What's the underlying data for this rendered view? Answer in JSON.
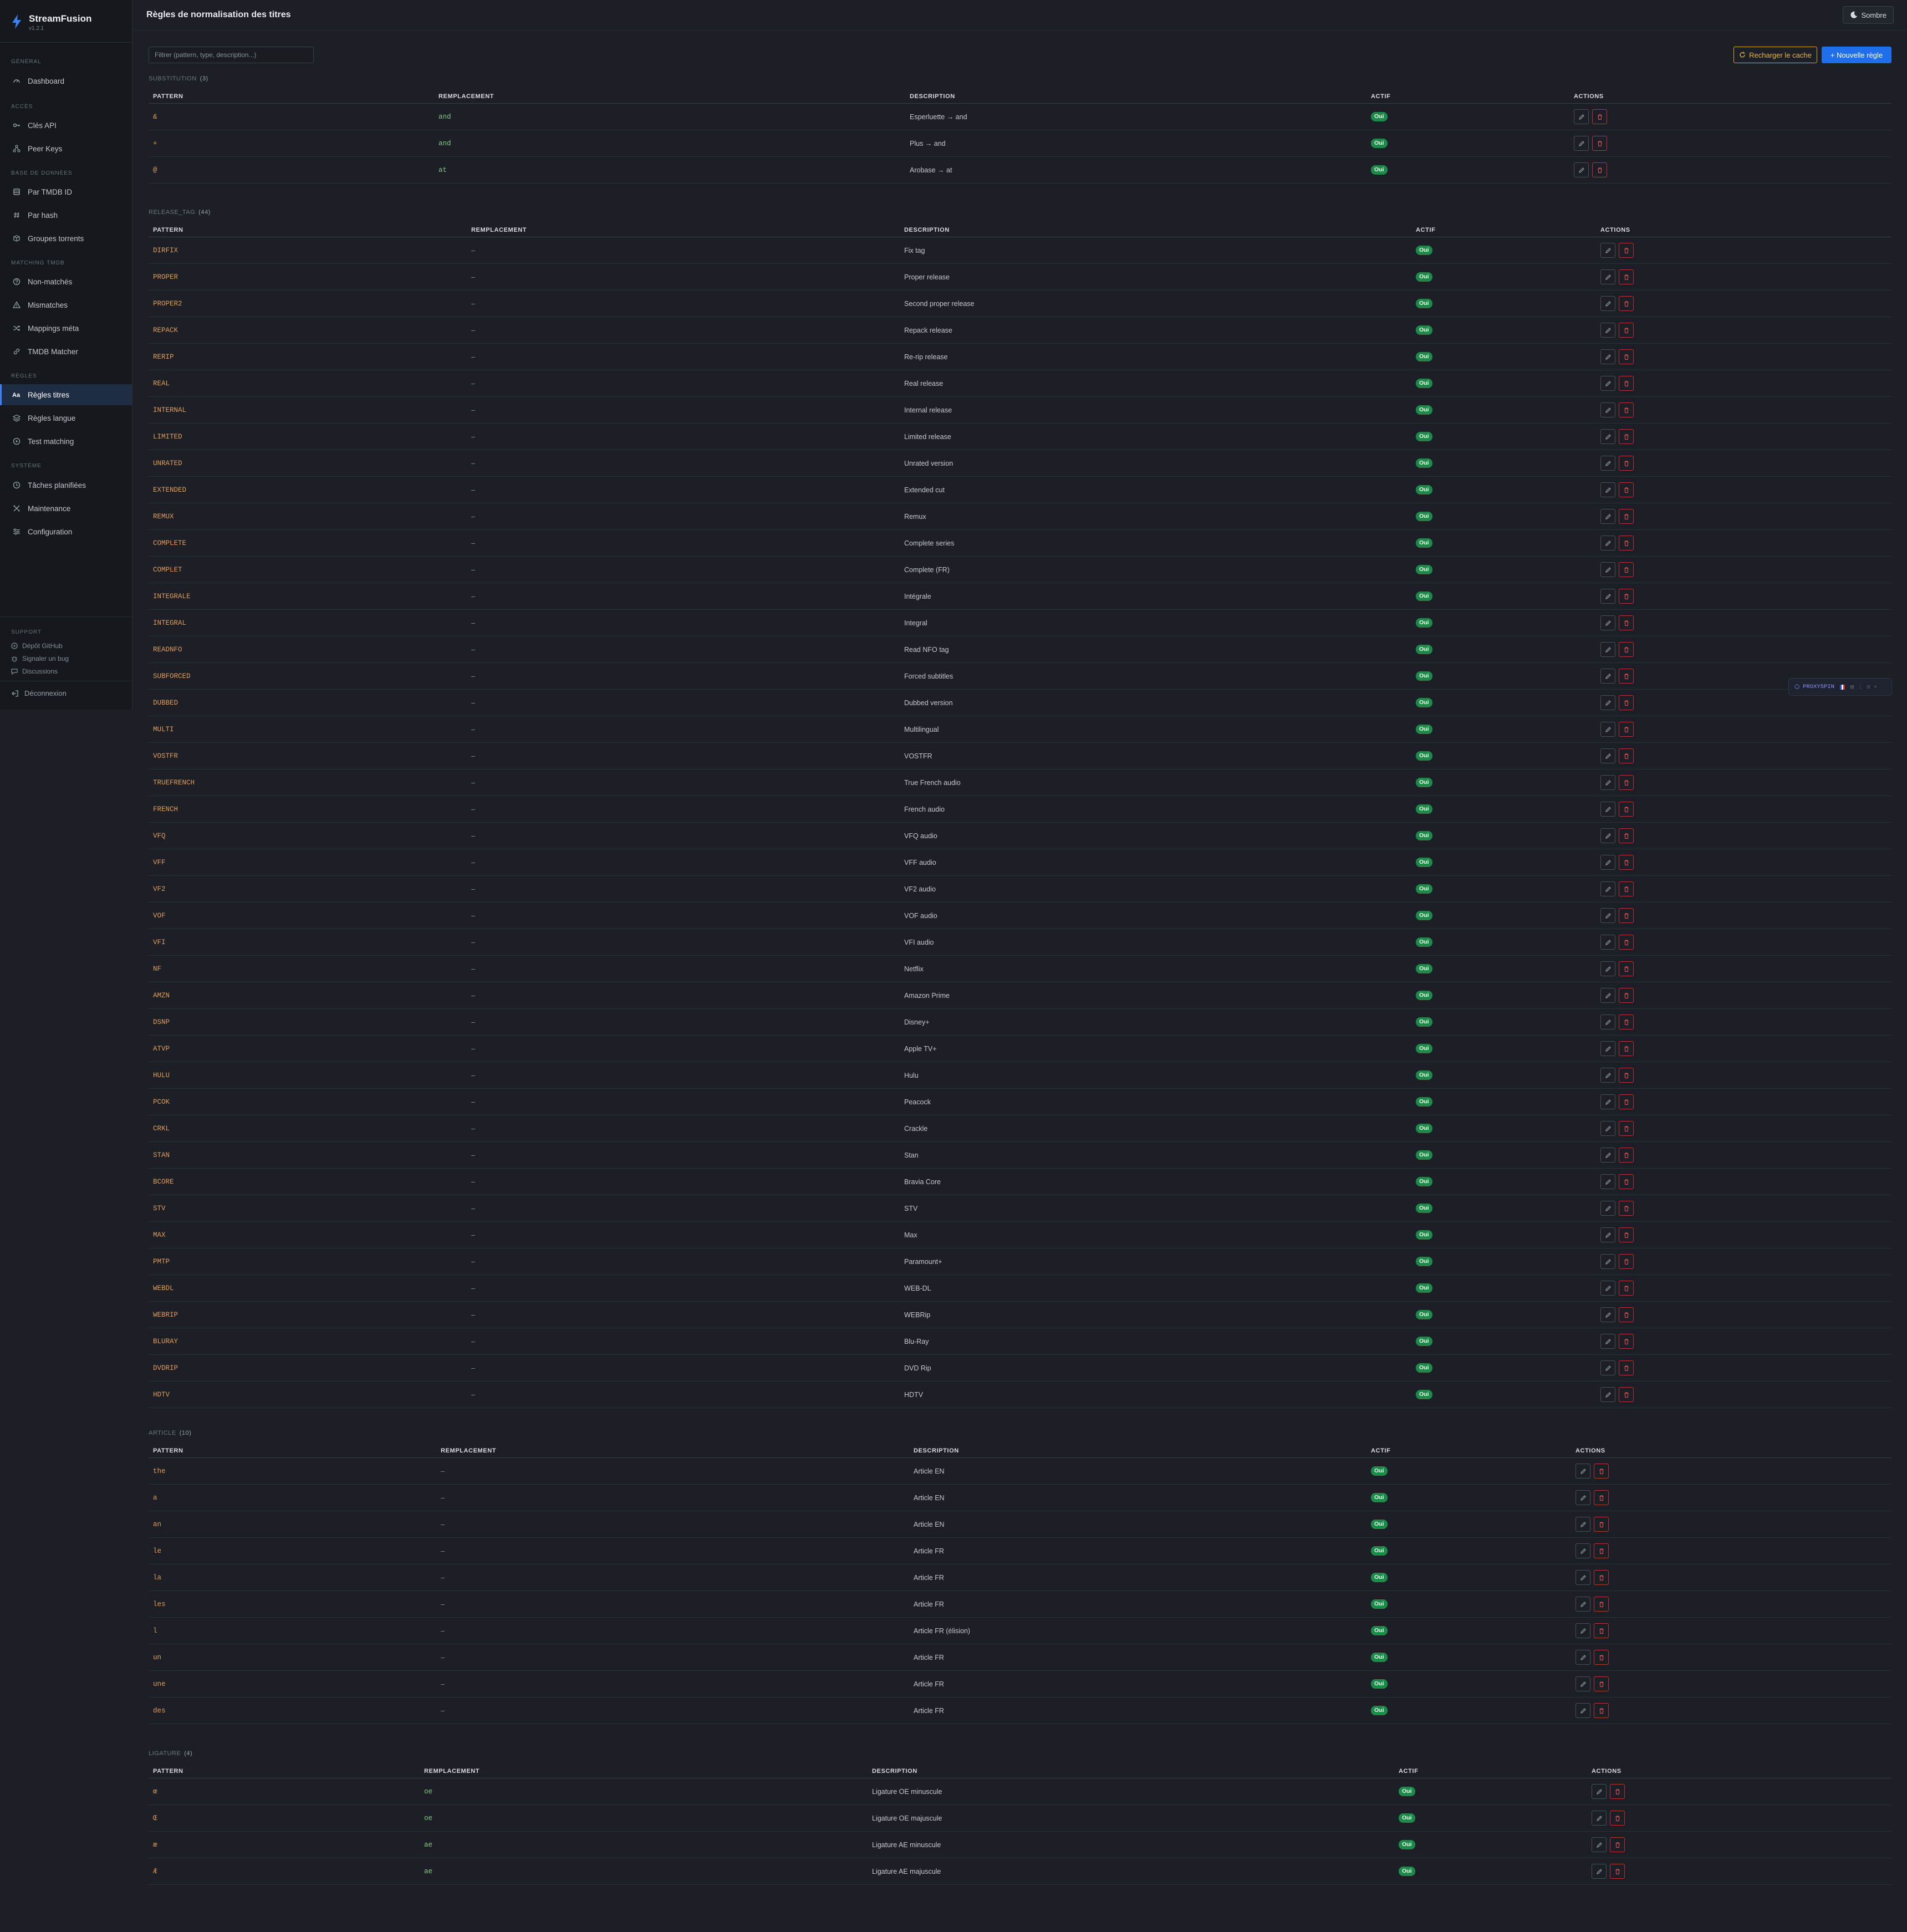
{
  "app": {
    "name": "StreamFusion",
    "version": "v1.2.1"
  },
  "header": {
    "title": "Règles de normalisation des titres",
    "theme_label": "Sombre"
  },
  "sidebar": {
    "sections": [
      {
        "label": "GÉNÉRAL",
        "items": [
          {
            "label": "Dashboard",
            "icon": "gauge-icon"
          }
        ]
      },
      {
        "label": "ACCÈS",
        "items": [
          {
            "label": "Clés API",
            "icon": "key-icon"
          },
          {
            "label": "Peer Keys",
            "icon": "network-icon"
          }
        ]
      },
      {
        "label": "BASE DE DONNÉES",
        "items": [
          {
            "label": "Par TMDB ID",
            "icon": "database-icon"
          },
          {
            "label": "Par hash",
            "icon": "hash-icon"
          },
          {
            "label": "Groupes torrents",
            "icon": "box-icon"
          }
        ]
      },
      {
        "label": "MATCHING TMDB",
        "items": [
          {
            "label": "Non-matchés",
            "icon": "question-icon"
          },
          {
            "label": "Mismatches",
            "icon": "warning-icon"
          },
          {
            "label": "Mappings méta",
            "icon": "shuffle-icon"
          },
          {
            "label": "TMDB Matcher",
            "icon": "link-icon"
          }
        ]
      },
      {
        "label": "RÈGLES",
        "items": [
          {
            "label": "Règles titres",
            "icon": "text-case-icon",
            "active": true
          },
          {
            "label": "Règles langue",
            "icon": "stack-icon"
          },
          {
            "label": "Test matching",
            "icon": "play-circle-icon"
          }
        ]
      },
      {
        "label": "SYSTÈME",
        "items": [
          {
            "label": "Tâches planifiées",
            "icon": "clock-icon"
          },
          {
            "label": "Maintenance",
            "icon": "tools-icon"
          },
          {
            "label": "Configuration",
            "icon": "sliders-icon"
          }
        ]
      }
    ],
    "support": {
      "label": "SUPPORT",
      "items": [
        {
          "label": "Dépôt GitHub",
          "icon": "github-icon"
        },
        {
          "label": "Signaler un bug",
          "icon": "bug-icon"
        },
        {
          "label": "Discussions",
          "icon": "chat-icon"
        }
      ]
    },
    "logout_label": "Déconnexion"
  },
  "toolbar": {
    "filter_placeholder": "Filtrer (pattern, type, description...)",
    "reload_label": "Recharger le cache",
    "new_label": "+ Nouvelle règle"
  },
  "columns": {
    "pattern": "PATTERN",
    "replacement": "REMPLACEMENT",
    "description": "DESCRIPTION",
    "active": "ACTIF",
    "actions": "ACTIONS"
  },
  "active_label": "Oui",
  "groups": [
    {
      "name": "SUBSTITUTION",
      "count": "(3)",
      "rows": [
        {
          "pattern": "&",
          "replacement": "and",
          "description": "Esperluette → and"
        },
        {
          "pattern": "+",
          "replacement": "and",
          "description": "Plus → and"
        },
        {
          "pattern": "@",
          "replacement": "at",
          "description": "Arobase → at"
        }
      ]
    },
    {
      "name": "RELEASE_TAG",
      "count": "(44)",
      "rows": [
        {
          "pattern": "DIRFIX",
          "replacement": "–",
          "description": "Fix tag"
        },
        {
          "pattern": "PROPER",
          "replacement": "–",
          "description": "Proper release"
        },
        {
          "pattern": "PROPER2",
          "replacement": "–",
          "description": "Second proper release"
        },
        {
          "pattern": "REPACK",
          "replacement": "–",
          "description": "Repack release"
        },
        {
          "pattern": "RERIP",
          "replacement": "–",
          "description": "Re-rip release"
        },
        {
          "pattern": "REAL",
          "replacement": "–",
          "description": "Real release"
        },
        {
          "pattern": "INTERNAL",
          "replacement": "–",
          "description": "Internal release"
        },
        {
          "pattern": "LIMITED",
          "replacement": "–",
          "description": "Limited release"
        },
        {
          "pattern": "UNRATED",
          "replacement": "–",
          "description": "Unrated version"
        },
        {
          "pattern": "EXTENDED",
          "replacement": "–",
          "description": "Extended cut"
        },
        {
          "pattern": "REMUX",
          "replacement": "–",
          "description": "Remux"
        },
        {
          "pattern": "COMPLETE",
          "replacement": "–",
          "description": "Complete series"
        },
        {
          "pattern": "COMPLET",
          "replacement": "–",
          "description": "Complete (FR)"
        },
        {
          "pattern": "INTEGRALE",
          "replacement": "–",
          "description": "Intégrale"
        },
        {
          "pattern": "INTEGRAL",
          "replacement": "–",
          "description": "Integral"
        },
        {
          "pattern": "READNFO",
          "replacement": "–",
          "description": "Read NFO tag"
        },
        {
          "pattern": "SUBFORCED",
          "replacement": "–",
          "description": "Forced subtitles"
        },
        {
          "pattern": "DUBBED",
          "replacement": "–",
          "description": "Dubbed version"
        },
        {
          "pattern": "MULTI",
          "replacement": "–",
          "description": "Multilingual"
        },
        {
          "pattern": "VOSTFR",
          "replacement": "–",
          "description": "VOSTFR"
        },
        {
          "pattern": "TRUEFRENCH",
          "replacement": "–",
          "description": "True French audio"
        },
        {
          "pattern": "FRENCH",
          "replacement": "–",
          "description": "French audio"
        },
        {
          "pattern": "VFQ",
          "replacement": "–",
          "description": "VFQ audio"
        },
        {
          "pattern": "VFF",
          "replacement": "–",
          "description": "VFF audio"
        },
        {
          "pattern": "VF2",
          "replacement": "–",
          "description": "VF2 audio"
        },
        {
          "pattern": "VOF",
          "replacement": "–",
          "description": "VOF audio"
        },
        {
          "pattern": "VFI",
          "replacement": "–",
          "description": "VFI audio"
        },
        {
          "pattern": "NF",
          "replacement": "–",
          "description": "Netflix"
        },
        {
          "pattern": "AMZN",
          "replacement": "–",
          "description": "Amazon Prime"
        },
        {
          "pattern": "DSNP",
          "replacement": "–",
          "description": "Disney+"
        },
        {
          "pattern": "ATVP",
          "replacement": "–",
          "description": "Apple TV+"
        },
        {
          "pattern": "HULU",
          "replacement": "–",
          "description": "Hulu"
        },
        {
          "pattern": "PCOK",
          "replacement": "–",
          "description": "Peacock"
        },
        {
          "pattern": "CRKL",
          "replacement": "–",
          "description": "Crackle"
        },
        {
          "pattern": "STAN",
          "replacement": "–",
          "description": "Stan"
        },
        {
          "pattern": "BCORE",
          "replacement": "–",
          "description": "Bravia Core"
        },
        {
          "pattern": "STV",
          "replacement": "–",
          "description": "STV"
        },
        {
          "pattern": "MAX",
          "replacement": "–",
          "description": "Max"
        },
        {
          "pattern": "PMTP",
          "replacement": "–",
          "description": "Paramount+"
        },
        {
          "pattern": "WEBDL",
          "replacement": "–",
          "description": "WEB-DL"
        },
        {
          "pattern": "WEBRIP",
          "replacement": "–",
          "description": "WEBRip"
        },
        {
          "pattern": "BLURAY",
          "replacement": "–",
          "description": "Blu-Ray"
        },
        {
          "pattern": "DVDRIP",
          "replacement": "–",
          "description": "DVD Rip"
        },
        {
          "pattern": "HDTV",
          "replacement": "–",
          "description": "HDTV"
        }
      ]
    },
    {
      "name": "ARTICLE",
      "count": "(10)",
      "rows": [
        {
          "pattern": "the",
          "replacement": "–",
          "description": "Article EN"
        },
        {
          "pattern": "a",
          "replacement": "–",
          "description": "Article EN"
        },
        {
          "pattern": "an",
          "replacement": "–",
          "description": "Article EN"
        },
        {
          "pattern": "le",
          "replacement": "–",
          "description": "Article FR"
        },
        {
          "pattern": "la",
          "replacement": "–",
          "description": "Article FR"
        },
        {
          "pattern": "les",
          "replacement": "–",
          "description": "Article FR"
        },
        {
          "pattern": "l",
          "replacement": "–",
          "description": "Article FR (élision)"
        },
        {
          "pattern": "un",
          "replacement": "–",
          "description": "Article FR"
        },
        {
          "pattern": "une",
          "replacement": "–",
          "description": "Article FR"
        },
        {
          "pattern": "des",
          "replacement": "–",
          "description": "Article FR"
        }
      ]
    },
    {
      "name": "LIGATURE",
      "count": "(4)",
      "rows": [
        {
          "pattern": "œ",
          "replacement": "oe",
          "description": "Ligature OE minuscule"
        },
        {
          "pattern": "Œ",
          "replacement": "oe",
          "description": "Ligature OE majuscule"
        },
        {
          "pattern": "æ",
          "replacement": "ae",
          "description": "Ligature AE minuscule"
        },
        {
          "pattern": "Æ",
          "replacement": "ae",
          "description": "Ligature AE majuscule"
        }
      ]
    }
  ],
  "proxy_widget": {
    "label": "PROXYSPIN"
  },
  "colors": {
    "accent": "#1f6feb",
    "warning": "#d9a520",
    "success": "#1e8a4a",
    "danger": "#b83434",
    "pattern": "#e39b5a",
    "replacement": "#86c98a"
  }
}
